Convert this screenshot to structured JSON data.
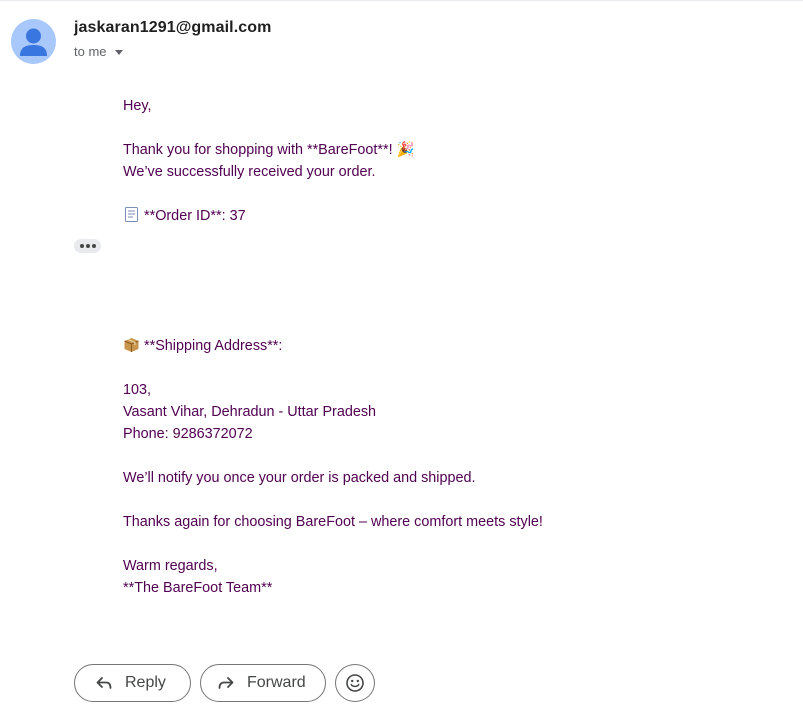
{
  "header": {
    "sender": "jaskaran1291@gmail.com",
    "recipient_label": "to me"
  },
  "message": {
    "greeting": "Hey,",
    "thanks_line": "Thank you for shopping with **BareFoot**! 🎉",
    "received_line": "We’ve successfully received your order.",
    "order_id_line": "**Order ID**: 37",
    "shipping_heading": "**Shipping Address**:",
    "address_line1": "103,",
    "address_line2": "Vasant Vihar, Dehradun - Uttar Pradesh",
    "phone_line": "Phone: 9286372072",
    "notify_line": "We’ll notify you once your order is packed and shipped.",
    "thanks_again_line": "Thanks again for choosing BareFoot – where comfort meets style!",
    "closing": "Warm regards,",
    "signature": "**The BareFoot Team**"
  },
  "actions": {
    "reply_label": "Reply",
    "forward_label": "Forward"
  },
  "icons": {
    "avatar": "person-avatar-icon",
    "caret": "chevron-down-icon",
    "order": "receipt-icon",
    "shipping": "package-icon",
    "ellipsis": "more-horizontal-icon",
    "reply": "reply-icon",
    "forward": "forward-icon",
    "emoji": "smiley-icon"
  },
  "colors": {
    "body_text": "#500050",
    "avatar_bg": "#a8c7fa",
    "avatar_fg": "#3a76e0"
  }
}
